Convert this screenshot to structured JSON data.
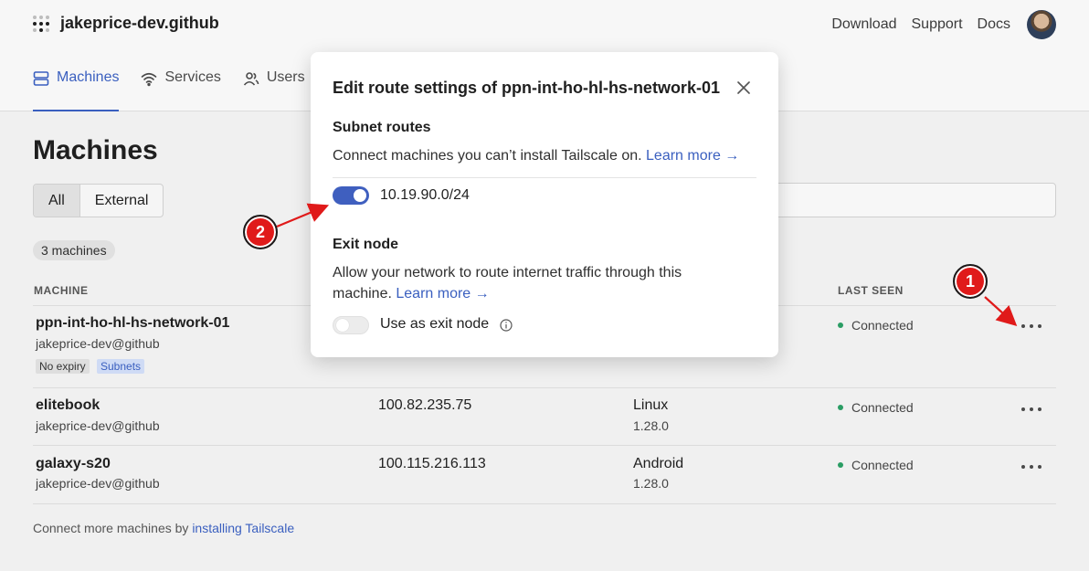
{
  "header": {
    "org_name": "jakeprice-dev.github",
    "links": [
      "Download",
      "Support",
      "Docs"
    ]
  },
  "tabs": [
    {
      "label": "Machines",
      "icon": "server-icon",
      "active": true
    },
    {
      "label": "Services",
      "icon": "wifi-icon",
      "active": false
    },
    {
      "label": "Users",
      "icon": "users-icon",
      "active": false
    }
  ],
  "page": {
    "title": "Machines",
    "filters": [
      "All",
      "External"
    ],
    "count": "3 machines"
  },
  "table": {
    "headers": {
      "machine": "MACHINE",
      "last_seen": "LAST SEEN"
    },
    "rows": [
      {
        "name": "ppn-int-ho-hl-hs-network-01",
        "owner": "jakeprice-dev@github",
        "address": "",
        "os": "",
        "version": "",
        "status": "Connected",
        "badges": [
          "No expiry",
          "Subnets"
        ]
      },
      {
        "name": "elitebook",
        "owner": "jakeprice-dev@github",
        "address": "100.82.235.75",
        "os": "Linux",
        "version": "1.28.0",
        "status": "Connected",
        "badges": []
      },
      {
        "name": "galaxy-s20",
        "owner": "jakeprice-dev@github",
        "address": "100.115.216.113",
        "os": "Android",
        "version": "1.28.0",
        "status": "Connected",
        "badges": []
      }
    ]
  },
  "footer": {
    "text": "Connect more machines by ",
    "link": "installing Tailscale"
  },
  "modal": {
    "title": "Edit route settings of ppn-int-ho-hl-hs-network-01",
    "subnet_heading": "Subnet routes",
    "subnet_desc": "Connect machines you can’t install Tailscale on.",
    "learn_more": "Learn more →",
    "route": "10.19.90.0/24",
    "route_enabled": true,
    "exit_heading": "Exit node",
    "exit_desc_line1": "Allow your network to route internet traffic through this",
    "exit_desc_line2": "machine.",
    "exit_label": "Use as exit node",
    "exit_enabled": false
  },
  "annotations": [
    "1",
    "2"
  ],
  "colors": {
    "accent": "#3a5fbf",
    "status_connected": "#2a9d64",
    "marker": "#e01a1a"
  }
}
